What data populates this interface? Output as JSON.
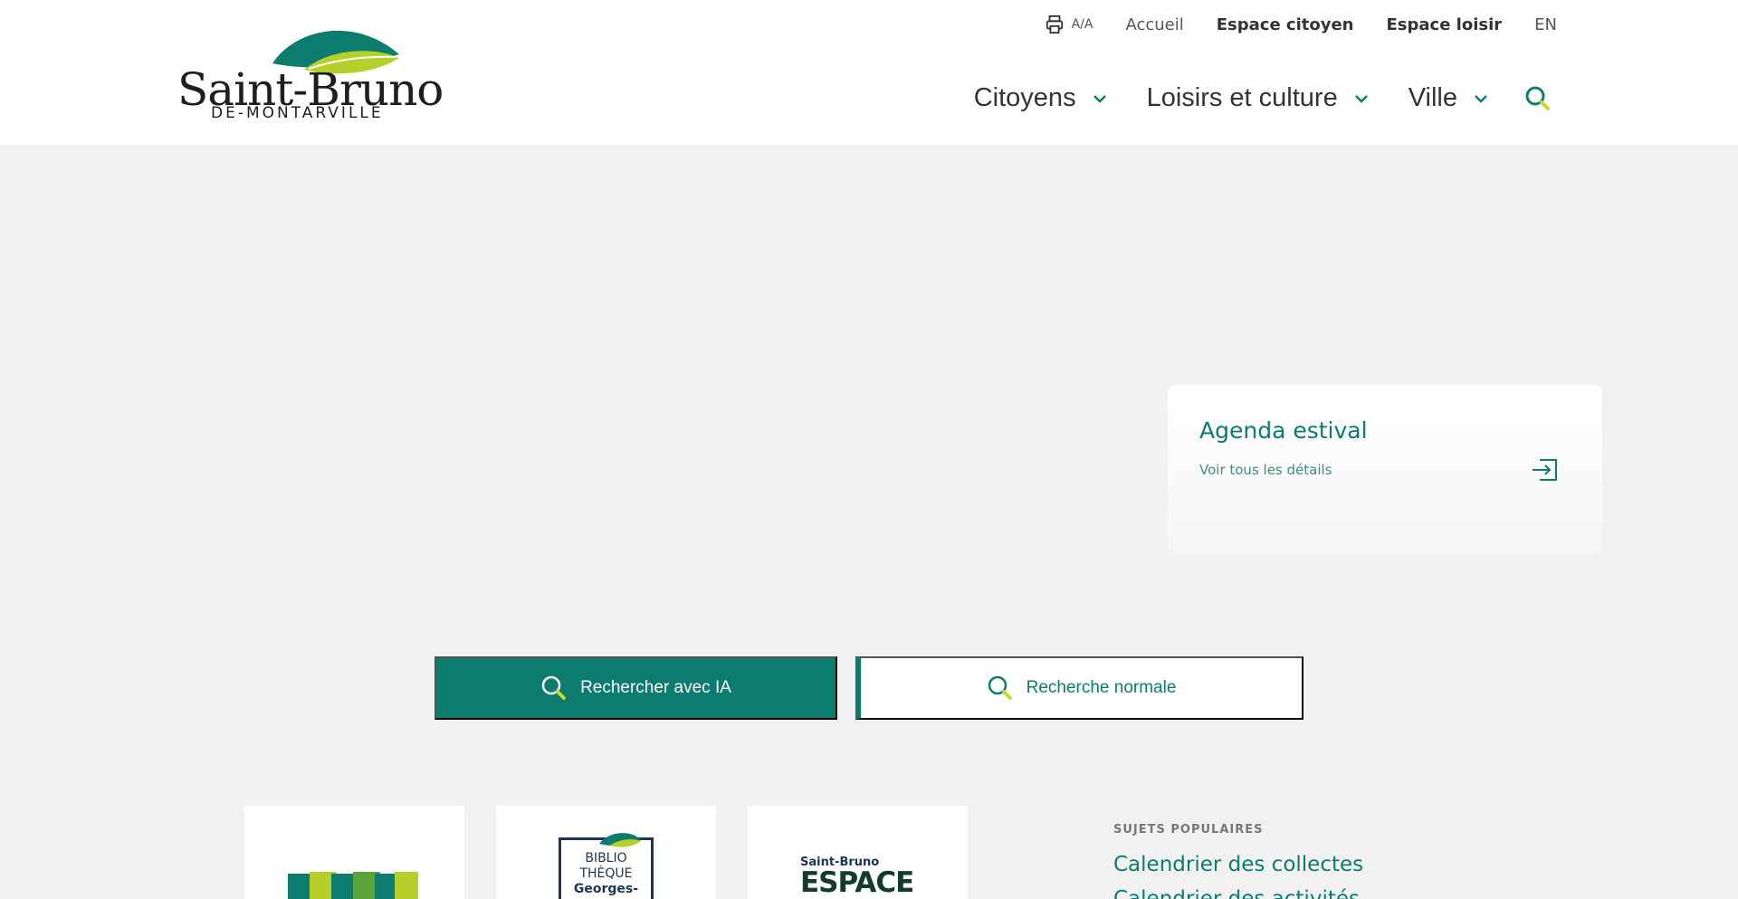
{
  "header": {
    "logo": {
      "title": "Saint-Bruno",
      "subtitle": "DE-MONTARVILLE"
    },
    "utility": {
      "print_icon": "printer-icon",
      "font_toggle": "A/A",
      "links": [
        {
          "label": "Accueil",
          "bold": false
        },
        {
          "label": "Espace citoyen",
          "bold": true
        },
        {
          "label": "Espace loisir",
          "bold": true
        },
        {
          "label": "EN",
          "bold": false
        }
      ]
    },
    "nav": [
      {
        "label": "Citoyens",
        "icon": "chevron-down-icon"
      },
      {
        "label": "Loisirs et culture",
        "icon": "chevron-down-icon"
      },
      {
        "label": "Ville",
        "icon": "chevron-down-icon"
      }
    ],
    "search_icon": "search-icon"
  },
  "hero": {
    "card": {
      "title": "Agenda estival",
      "link": "Voir tous les détails",
      "icon": "arrow-into-box-icon"
    }
  },
  "search": {
    "ia_label": "Rechercher avec IA",
    "normal_label": "Recherche normale"
  },
  "tiles": {
    "biblio": {
      "line1": "BIBLIO",
      "line2": "THÈQUE",
      "line3": "Georges-"
    },
    "espace_citoyen": {
      "small": "Saint-Bruno",
      "big": "ESPACE"
    }
  },
  "popular": {
    "title": "SUJETS POPULAIRES",
    "items": [
      "Calendrier des collectes",
      "Calendrier des activités"
    ]
  },
  "colors": {
    "brand_green": "#0b7c6d",
    "accent_lime": "#c5d82c",
    "background": "#f1f1f1"
  }
}
